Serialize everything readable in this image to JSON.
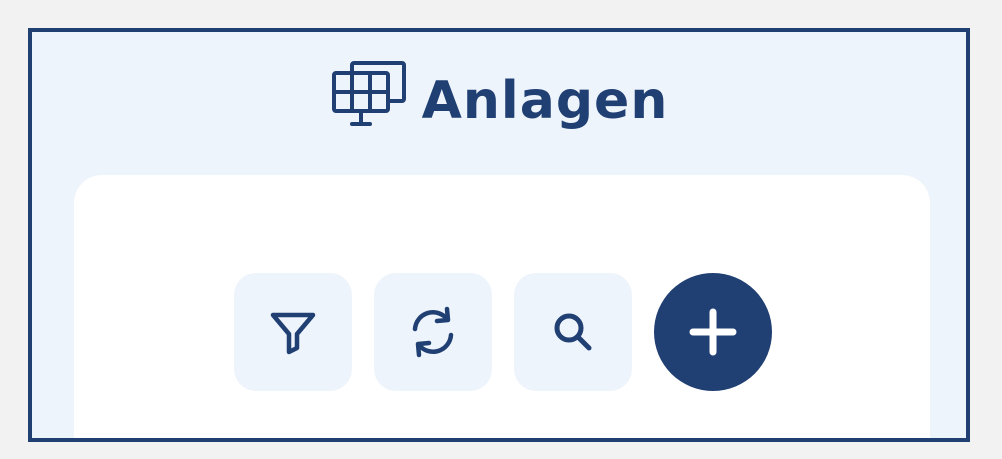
{
  "header": {
    "title": "Anlagen",
    "icon": "solar-panel-icon"
  },
  "toolbar": {
    "buttons": [
      {
        "icon": "filter-icon"
      },
      {
        "icon": "refresh-icon"
      },
      {
        "icon": "search-icon"
      },
      {
        "icon": "plus-icon"
      }
    ]
  },
  "colors": {
    "brand": "#203f73",
    "panel_background": "#eef4fb",
    "card_background": "#ffffff",
    "page_background": "#f2f2f2"
  }
}
